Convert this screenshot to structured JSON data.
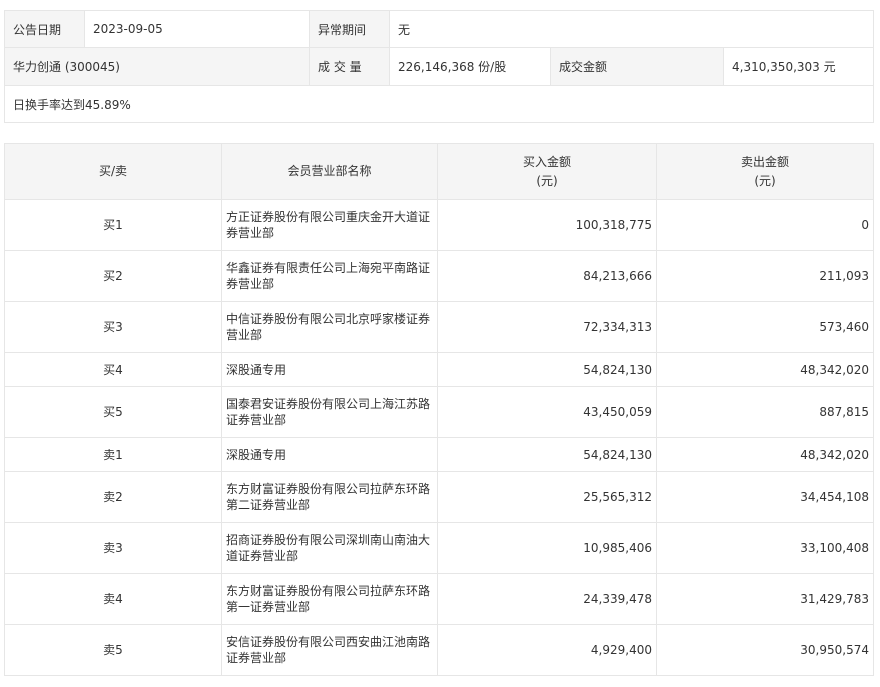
{
  "info": {
    "announce_date_label": "公告日期",
    "announce_date_value": "2023-09-05",
    "abnormal_period_label": "异常期间",
    "abnormal_period_value": "无",
    "stock_name": "华力创通 (300045)",
    "volume_label": "成 交 量",
    "volume_value": "226,146,368 份/股",
    "amount_label": "成交金额",
    "amount_value": "4,310,350,303 元",
    "reason": "日换手率达到45.89%"
  },
  "trade_table": {
    "headers": {
      "side": "买/卖",
      "branch": "会员营业部名称",
      "buy_line1": "买入金额",
      "buy_line2": "(元)",
      "sell_line1": "卖出金额",
      "sell_line2": "(元)"
    },
    "rows": [
      {
        "side": "买1",
        "branch": "方正证券股份有限公司重庆金开大道证券营业部",
        "buy": "100,318,775",
        "sell": "0"
      },
      {
        "side": "买2",
        "branch": "华鑫证券有限责任公司上海宛平南路证券营业部",
        "buy": "84,213,666",
        "sell": "211,093"
      },
      {
        "side": "买3",
        "branch": "中信证券股份有限公司北京呼家楼证券营业部",
        "buy": "72,334,313",
        "sell": "573,460"
      },
      {
        "side": "买4",
        "branch": "深股通专用",
        "buy": "54,824,130",
        "sell": "48,342,020"
      },
      {
        "side": "买5",
        "branch": "国泰君安证券股份有限公司上海江苏路证券营业部",
        "buy": "43,450,059",
        "sell": "887,815"
      },
      {
        "side": "卖1",
        "branch": "深股通专用",
        "buy": "54,824,130",
        "sell": "48,342,020"
      },
      {
        "side": "卖2",
        "branch": "东方财富证券股份有限公司拉萨东环路第二证券营业部",
        "buy": "25,565,312",
        "sell": "34,454,108"
      },
      {
        "side": "卖3",
        "branch": "招商证券股份有限公司深圳南山南油大道证券营业部",
        "buy": "10,985,406",
        "sell": "33,100,408"
      },
      {
        "side": "卖4",
        "branch": "东方财富证券股份有限公司拉萨东环路第一证券营业部",
        "buy": "24,339,478",
        "sell": "31,429,783"
      },
      {
        "side": "卖5",
        "branch": "安信证券股份有限公司西安曲江池南路证券营业部",
        "buy": "4,929,400",
        "sell": "30,950,574"
      }
    ]
  }
}
